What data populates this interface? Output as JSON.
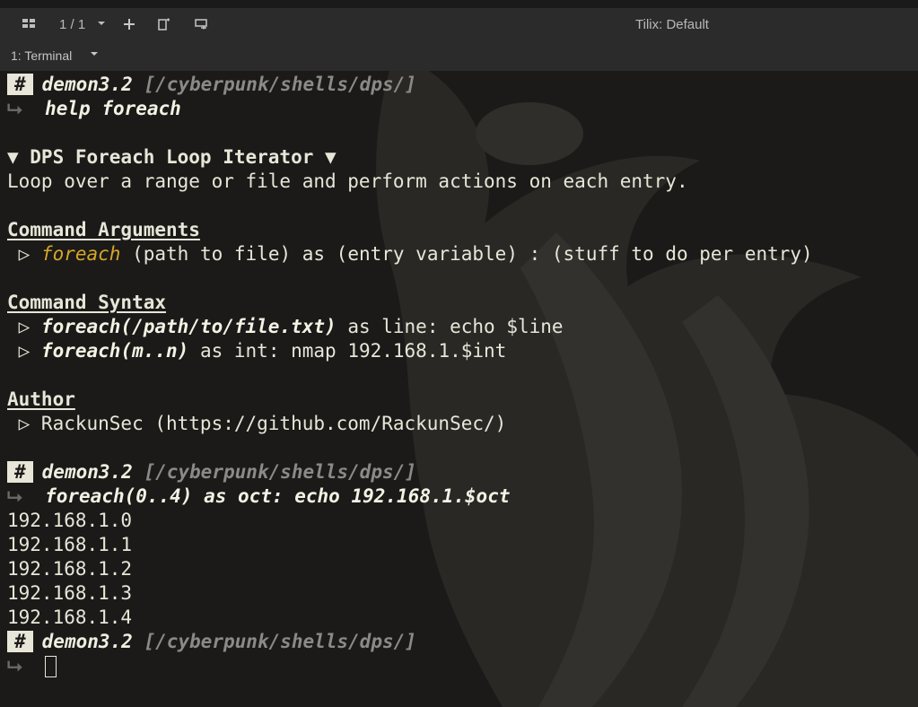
{
  "titlebar": {
    "session_count": "1 / 1",
    "window_title": "Tilix: Default",
    "tab_label": "1: Terminal"
  },
  "icons": [
    "grid-icon",
    "chevron-down-icon",
    "plus-icon",
    "split-vertical-icon",
    "split-horizontal-icon"
  ],
  "prompt": {
    "hash": "#",
    "host": "demon3.2",
    "path": "[/cyberpunk/shells/dps/]",
    "arrow": "⮡"
  },
  "terminal": {
    "cmd1": "help foreach",
    "heading": "▼ DPS Foreach Loop Iterator ▼",
    "description": "Loop over a range or file and perform actions on each entry.",
    "args_title": "Command Arguments",
    "args_bullet": " ▷ ",
    "args_keyword": "foreach",
    "args_rest": " (path to file) as (entry variable) : (stuff to do per entry)",
    "syntax_title": "Command Syntax",
    "syntax1_bullet": " ▷ ",
    "syntax1_cmd": "foreach(/path/to/file.txt)",
    "syntax1_rest": " as line: echo $line",
    "syntax2_bullet": " ▷ ",
    "syntax2_cmd": "foreach(m..n)",
    "syntax2_rest": " as int: nmap 192.168.1.$int",
    "author_title": "Author",
    "author_line": " ▷ RackunSec (https://github.com/RackunSec/)",
    "cmd2": "foreach(0..4) as oct: echo 192.168.1.$oct",
    "outputs": [
      "192.168.1.0",
      "192.168.1.1",
      "192.168.1.2",
      "192.168.1.3",
      "192.168.1.4"
    ]
  },
  "colors": {
    "background": "#1b1a18",
    "foreground": "#e8e6d8",
    "keyword": "#d4a62a",
    "path": "#8a8a86",
    "titlebar": "#2b2b2b"
  }
}
